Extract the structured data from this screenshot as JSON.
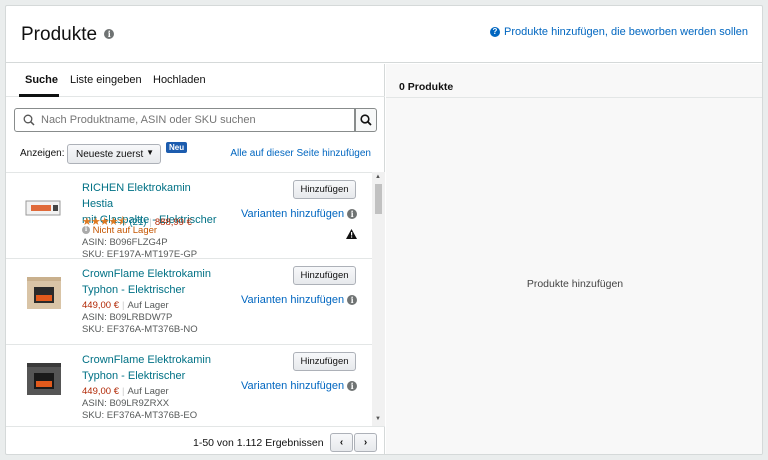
{
  "header": {
    "title": "Produkte",
    "help_link": "Produkte hinzufügen, die beworben werden sollen"
  },
  "tabs": [
    {
      "label": "Suche",
      "active": true
    },
    {
      "label": "Liste eingeben",
      "active": false
    },
    {
      "label": "Hochladen",
      "active": false
    }
  ],
  "search": {
    "placeholder": "Nach Produktname, ASIN oder SKU suchen"
  },
  "filter": {
    "show_label": "Anzeigen:",
    "sort_value": "Neueste zuerst",
    "new_badge": "Neu",
    "add_all_label": "Alle auf dieser Seite hinzufügen"
  },
  "products": [
    {
      "title_line1": "RICHEN Elektrokamin Hestia",
      "title_line2": "mit Glaspaltte - Elektrischer",
      "rating_stars": 4.5,
      "rating_count": "(21)",
      "price": "888,99 €",
      "stock": "Nicht auf Lager",
      "asin": "ASIN: B096FLZG4P",
      "sku": "SKU: EF197A-MT197E-GP",
      "add_label": "Hinzufügen",
      "variants_label": "Varianten hinzufügen",
      "warning": true
    },
    {
      "title_line1": "CrownFlame Elektrokamin",
      "title_line2": "Typhon - Elektrischer",
      "price": "449,00 €",
      "stock": "Auf Lager",
      "asin": "ASIN: B09LRBDW7P",
      "sku": "SKU: EF376A-MT376B-NO",
      "add_label": "Hinzufügen",
      "variants_label": "Varianten hinzufügen"
    },
    {
      "title_line1": "CrownFlame Elektrokamin",
      "title_line2": "Typhon - Elektrischer",
      "price": "449,00 €",
      "stock": "Auf Lager",
      "asin": "ASIN: B09LR9ZRXX",
      "sku": "SKU: EF376A-MT376B-EO",
      "add_label": "Hinzufügen",
      "variants_label": "Varianten hinzufügen"
    }
  ],
  "pagination": {
    "results": "1-50 von 1.112 Ergebnissen",
    "prev": "‹",
    "next": "›"
  },
  "selected": {
    "count_label": "0 Produkte",
    "empty_label": "Produkte hinzufügen"
  },
  "colors": {
    "link": "#0066c0",
    "product_link": "#007185",
    "price": "#b12704",
    "star": "#de7921"
  },
  "icons": [
    "info-icon",
    "help-icon",
    "search-icon",
    "chevron-down-icon",
    "star-icon",
    "warning-icon",
    "chevron-left-icon",
    "chevron-right-icon"
  ]
}
